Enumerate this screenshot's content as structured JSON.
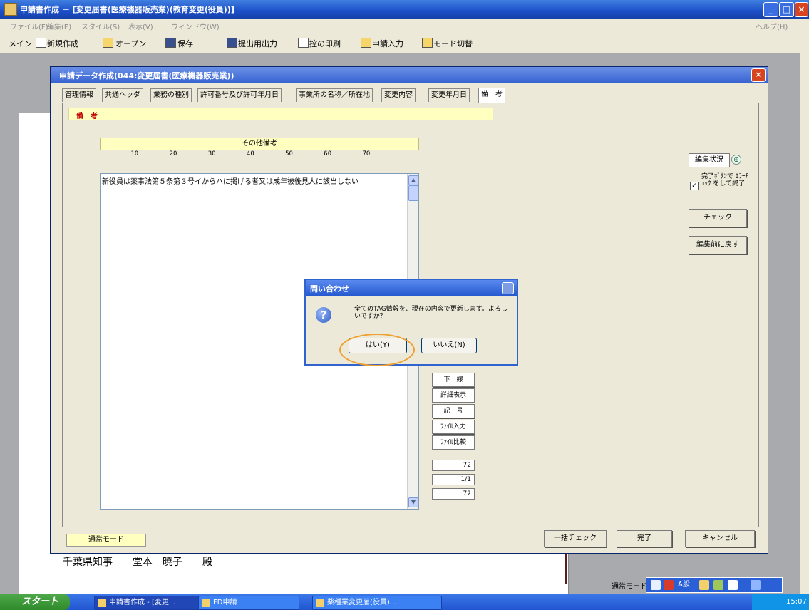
{
  "app": {
    "title": "申請書作成 － [変更届書(医療機器販売業)(教育変更(役員))]",
    "window_buttons": [
      "_",
      "□",
      "×"
    ]
  },
  "menu": [
    "ファイル(F)",
    "編集(E)",
    "スタイル(S)",
    "表示(V)",
    "ウィンドウ(W)",
    "ヘルプ(H)"
  ],
  "toolbar": [
    "メイン",
    "新規作成",
    "オープン",
    "保存",
    "提出用出力",
    "控の印刷",
    "申請入力",
    "モード切替"
  ],
  "document": {
    "signature": "千葉県知事　　堂本　暁子　　殿"
  },
  "window": {
    "title": "申請データ作成(044:変更届書(医療機器販売業))",
    "tabs": [
      "管理情報",
      "共通ヘッダ",
      "業務の種別",
      "許可番号及び許可年月日",
      "事業所の名称／所在地",
      "変更内容",
      "変更年月日",
      "備　考"
    ],
    "active_tab": "備　考",
    "section_label": "備　考",
    "field_header": "その他備考",
    "ruler": "        10        20        30        40        50        60        70",
    "textarea_content": "新役員は薬事法第５条第３号イからハに掲げる者又は成年被後見人に該当しない",
    "side_buttons": [
      "下　線",
      "詳細表示",
      "記　号",
      "ﾌｧｲﾙ入力",
      "ﾌｧｲﾙ比較"
    ],
    "counters": [
      "72",
      "1/1",
      "72"
    ],
    "edit_status": "編集状況",
    "checkbox_label": "完了ﾎﾞﾀﾝで ｴﾗｰﾁｪｯｸ をして終了",
    "checkbox_checked": "✓",
    "check_button": "チェック",
    "revert_button": "編集前に戻す",
    "mode": "通常モード",
    "bulk_check": "一括チェック",
    "done": "完了",
    "cancel": "キャンセル"
  },
  "dialog": {
    "title": "問い合わせ",
    "message": "全てのTAG情報を、現在の内容で更新します。よろしいですか？",
    "icon": "?",
    "yes": "はい(Y)",
    "no": "いいえ(N)"
  },
  "ime": {
    "label": "通常モード",
    "mode": "A般"
  },
  "taskbar": {
    "start": "スタート",
    "tasks": [
      "申請書作成 - [変更...",
      "FD申請",
      "薬種業変更届(役員)..."
    ],
    "clock": "15:07"
  }
}
